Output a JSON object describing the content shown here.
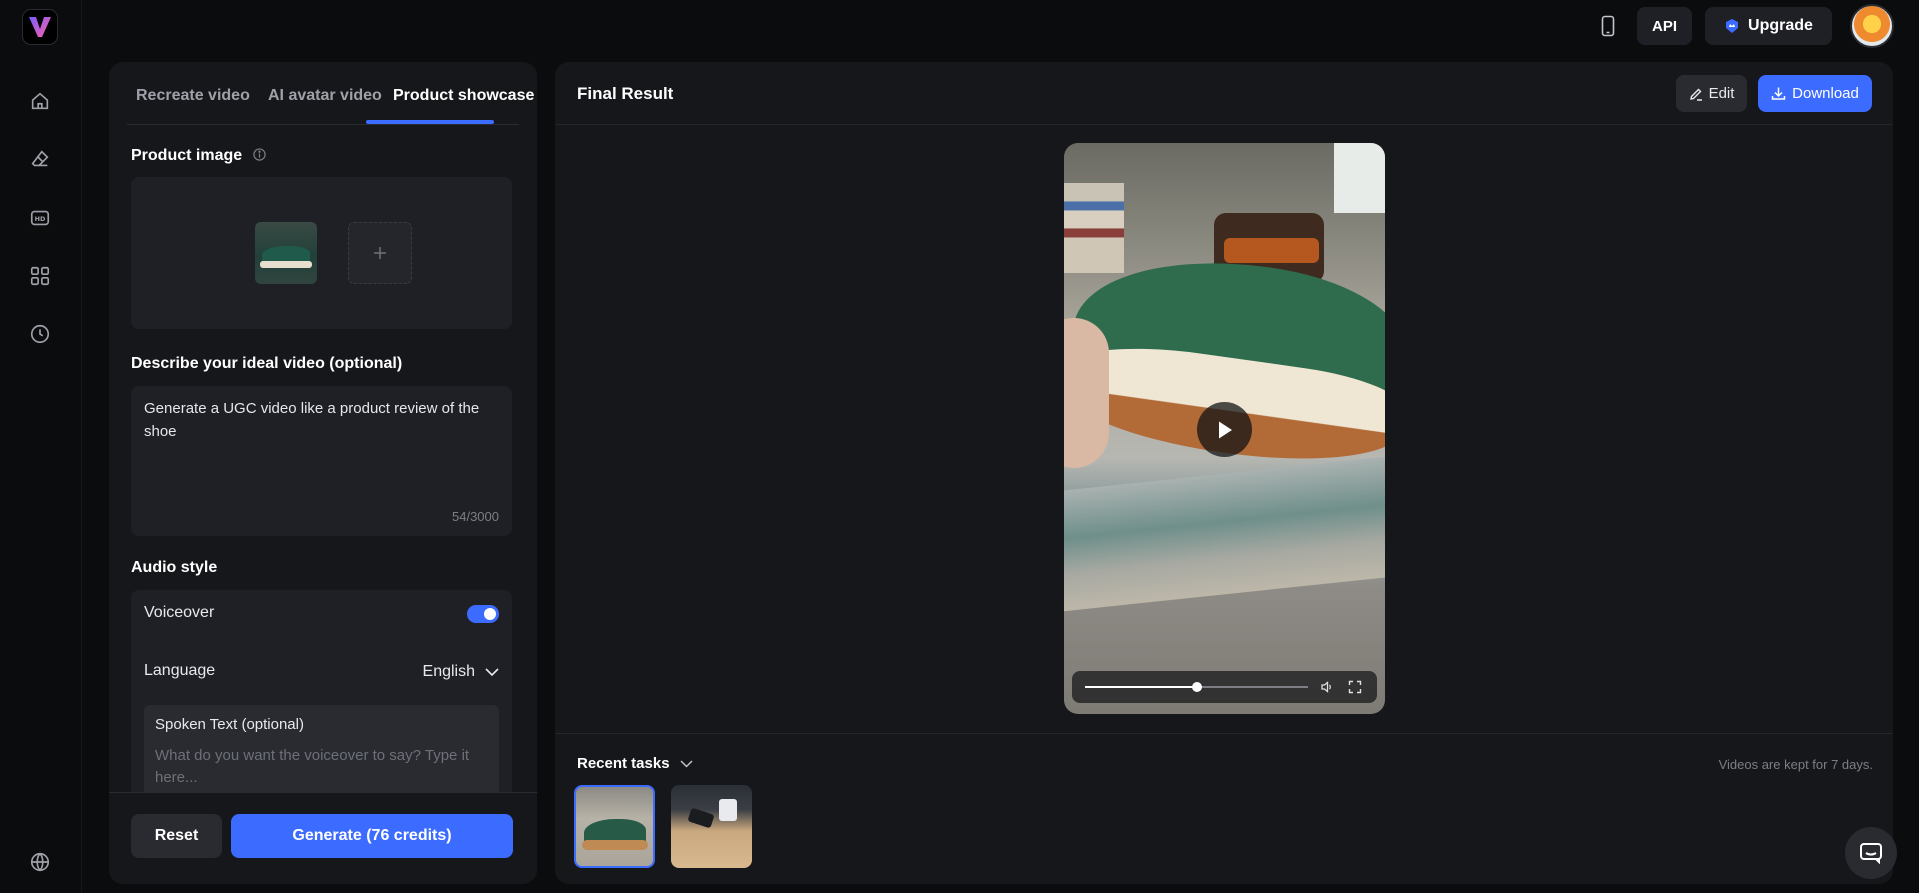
{
  "brand": {
    "logo_letter": "V",
    "accent": "#3c6bff"
  },
  "rail": {
    "items": [
      {
        "name": "home-icon"
      },
      {
        "name": "eraser-icon"
      },
      {
        "name": "hd-icon",
        "label": "HD"
      },
      {
        "name": "apps-grid-icon"
      },
      {
        "name": "history-clock-icon"
      },
      {
        "name": "globe-icon"
      }
    ]
  },
  "topbar": {
    "api_label": "API",
    "upgrade_label": "Upgrade"
  },
  "left_panel": {
    "tabs": [
      {
        "label": "Recreate video",
        "active": false
      },
      {
        "label": "AI avatar video",
        "active": false
      },
      {
        "label": "Product showcase",
        "active": true
      }
    ],
    "product_image_label": "Product image",
    "describe_label": "Describe your ideal video (optional)",
    "describe_value": "Generate a UGC video like a product review of the shoe",
    "describe_counter": "54/3000",
    "audio_style_label": "Audio style",
    "voiceover_label": "Voiceover",
    "voiceover_on": true,
    "language_label": "Language",
    "language_value": "English",
    "spoken_text_label": "Spoken Text (optional)",
    "spoken_text_placeholder": "What do you want the voiceover to say? Type it here...",
    "reset_label": "Reset",
    "generate_label": "Generate (76 credits)"
  },
  "result": {
    "title": "Final Result",
    "edit_label": "Edit",
    "download_label": "Download",
    "video_progress": 0.5,
    "recent_tasks_label": "Recent tasks",
    "keep_note": "Videos are kept for 7 days."
  }
}
